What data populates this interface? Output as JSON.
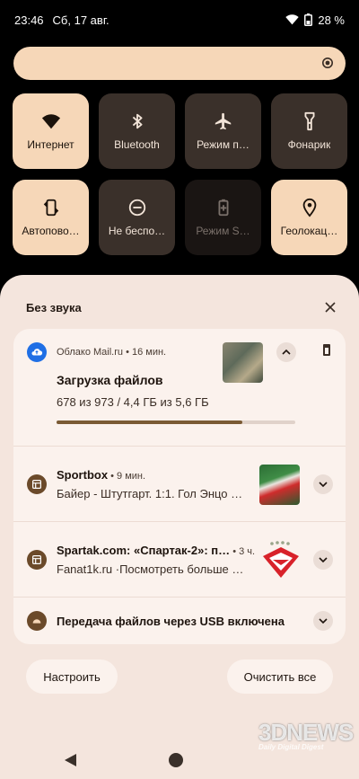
{
  "status": {
    "time": "23:46",
    "date": "Сб, 17 авг.",
    "battery": "28 %"
  },
  "tiles": [
    {
      "label": "Интернет",
      "icon": "wifi-icon",
      "state": "on"
    },
    {
      "label": "Bluetooth",
      "icon": "bluetooth-icon",
      "state": "off"
    },
    {
      "label": "Режим п…",
      "icon": "airplane-icon",
      "state": "off"
    },
    {
      "label": "Фонарик",
      "icon": "flashlight-icon",
      "state": "off"
    },
    {
      "label": "Автопово…",
      "icon": "autorotate-icon",
      "state": "on"
    },
    {
      "label": "Не беспо…",
      "icon": "do-not-disturb-icon",
      "state": "off"
    },
    {
      "label": "Режим S…",
      "icon": "battery-saver-icon",
      "state": "dim"
    },
    {
      "label": "Геолокац…",
      "icon": "location-icon",
      "state": "on"
    }
  ],
  "panel": {
    "title": "Без звука"
  },
  "notifications": [
    {
      "app": "Облако Mail.ru",
      "time": "16 мин.",
      "title": "Загрузка файлов",
      "text": "678 из 973 / 4,4 ГБ из 5,6 ГБ",
      "progress": 0.78
    },
    {
      "app": "Sportbox",
      "time": "9 мин.",
      "text": "Байер - Штутгарт. 1:1. Гол Энцо М…"
    },
    {
      "app": "Spartak.com: «Спартак-2»: п…",
      "time": "3 ч.",
      "text": "Fanat1k.ru ·Посмотреть больше п…"
    },
    {
      "text": "Передача файлов через USB включена"
    }
  ],
  "buttons": {
    "settings": "Настроить",
    "clear_all": "Очистить все"
  },
  "watermark": {
    "big": "3DNEWS",
    "small": "Daily Digital Digest"
  },
  "colors": {
    "accent": "#f6d7b8",
    "tile_off": "#3a302a",
    "progress": "#7a5a34"
  }
}
